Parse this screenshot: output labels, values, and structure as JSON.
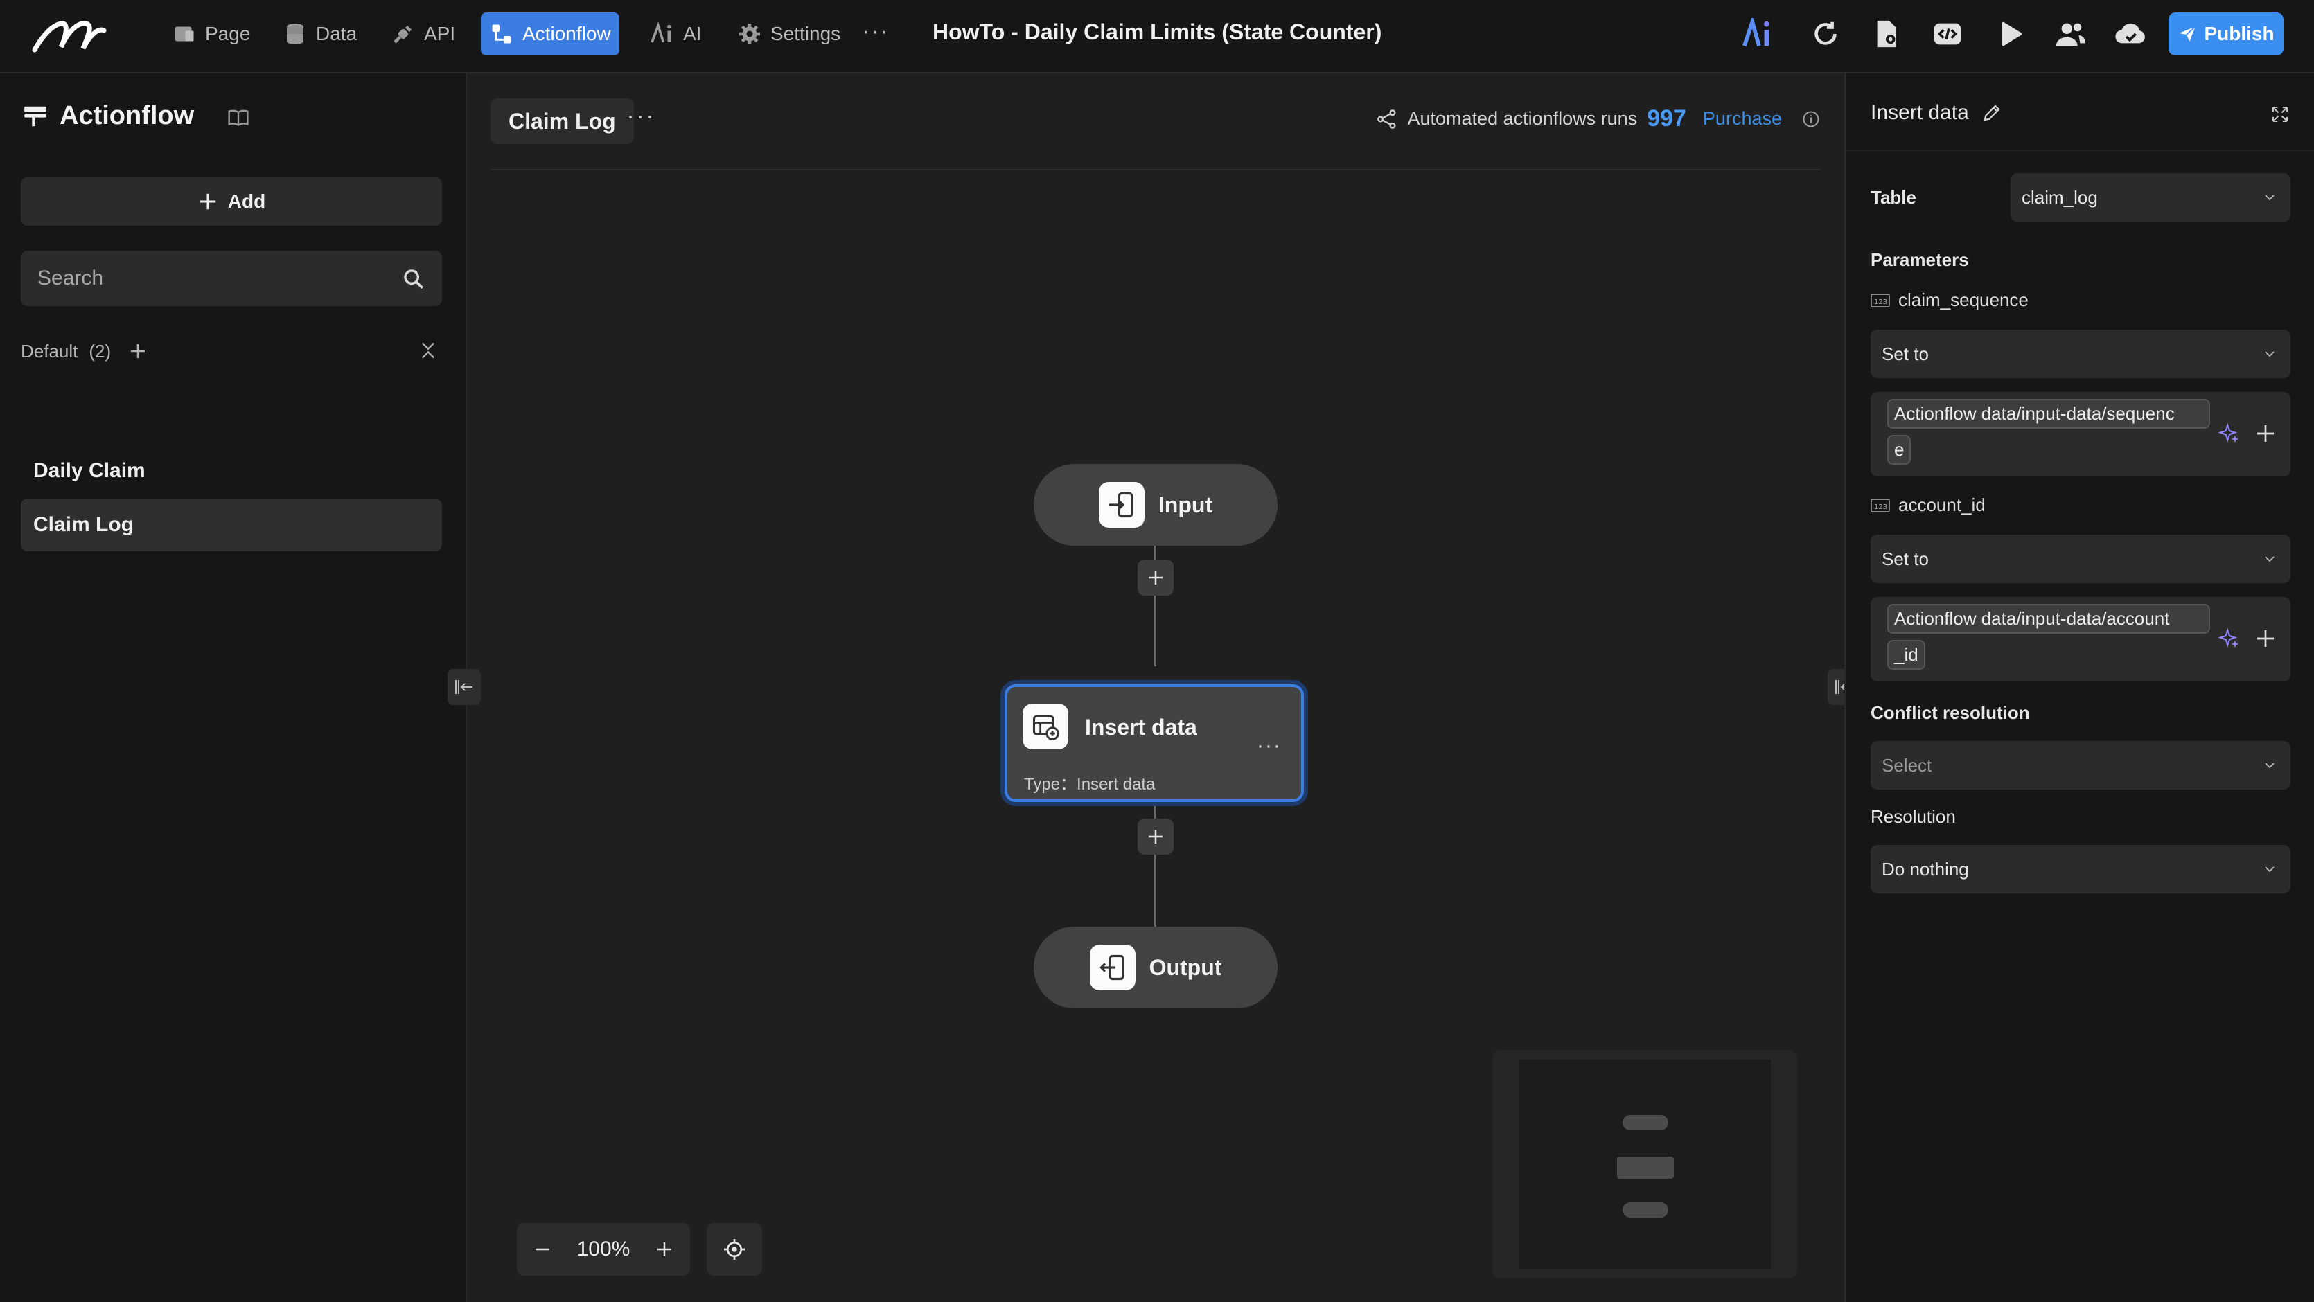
{
  "header": {
    "nav": [
      {
        "label": "Page",
        "icon": "page-icon"
      },
      {
        "label": "Data",
        "icon": "database-icon"
      },
      {
        "label": "API",
        "icon": "plug-icon"
      },
      {
        "label": "Actionflow",
        "icon": "flow-icon",
        "active": true
      },
      {
        "label": "AI",
        "icon": "ai-icon"
      },
      {
        "label": "Settings",
        "icon": "gear-icon"
      }
    ],
    "more": "···",
    "project_title": "HowTo - Daily Claim Limits (State Counter)",
    "publish_label": "Publish"
  },
  "sidebar": {
    "title": "Actionflow",
    "add_label": "Add",
    "search_placeholder": "Search",
    "group": {
      "name": "Default",
      "count": "(2)"
    },
    "items": [
      {
        "label": "Daily Claim",
        "selected": false
      },
      {
        "label": "Claim Log",
        "selected": true
      }
    ]
  },
  "canvas": {
    "tab_label": "Claim Log",
    "tab_more": "···",
    "runs_label": "Automated actionflows runs",
    "runs_count": "997",
    "purchase_label": "Purchase",
    "nodes": {
      "input": "Input",
      "insert": {
        "title": "Insert data",
        "type_label": "Type：Insert data",
        "more": "···"
      },
      "output": "Output"
    },
    "zoom": {
      "level": "100%"
    }
  },
  "panel": {
    "title": "Insert data",
    "table_label": "Table",
    "table_value": "claim_log",
    "parameters_label": "Parameters",
    "params": [
      {
        "name": "claim_sequence",
        "mode": "Set to",
        "chip_line1": "Actionflow data/input-data/sequenc",
        "chip_line2": "e"
      },
      {
        "name": "account_id",
        "mode": "Set to",
        "chip_line1": "Actionflow data/input-data/account",
        "chip_line2": "_id"
      }
    ],
    "conflict_label": "Conflict resolution",
    "conflict_placeholder": "Select",
    "resolution_label": "Resolution",
    "resolution_value": "Do nothing"
  },
  "colors": {
    "accent": "#3b7de0",
    "publish": "#3a8ef0",
    "runs_count": "#4a9af5",
    "sparkle": "#8e83f5"
  }
}
